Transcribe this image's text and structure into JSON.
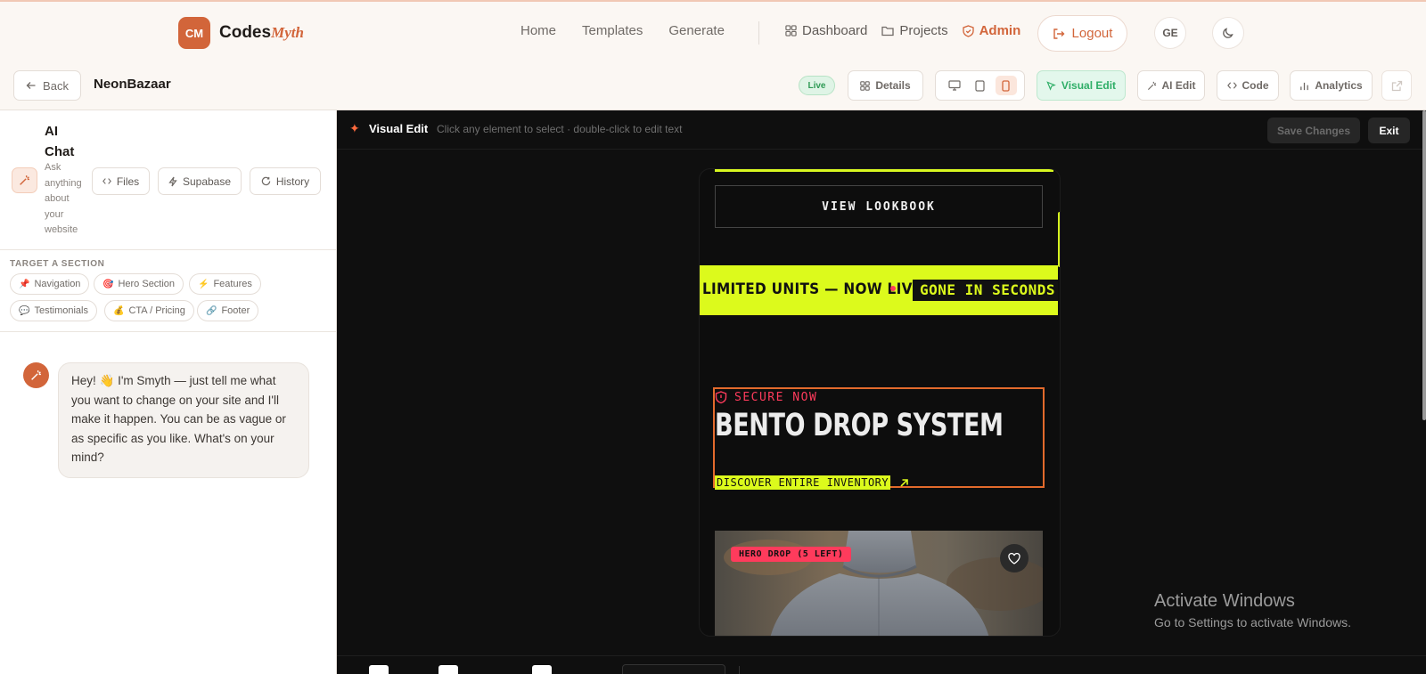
{
  "brand": {
    "mark": "CM",
    "name": "Codes",
    "accent": "Myth",
    "accent_color": "#d2653a"
  },
  "nav": {
    "links": [
      "Home",
      "Templates",
      "Generate"
    ],
    "dashboard": "Dashboard",
    "projects": "Projects",
    "admin": "Admin",
    "logout": "Logout",
    "avatar_initials": "GE"
  },
  "project": {
    "back": "Back",
    "name": "NeonBazaar",
    "status": "Live",
    "details": "Details",
    "visual_edit": "Visual Edit",
    "ai_edit": "AI Edit",
    "code": "Code",
    "analytics": "Analytics",
    "active_device": "mobile"
  },
  "chat": {
    "title": "AI Chat",
    "subtitle": "Ask anything about your website",
    "tools": [
      "Files",
      "Supabase",
      "History"
    ],
    "target_label": "TARGET A SECTION",
    "sections": [
      {
        "emoji": "📌",
        "label": "Navigation"
      },
      {
        "emoji": "🎯",
        "label": "Hero Section"
      },
      {
        "emoji": "⚡",
        "label": "Features"
      },
      {
        "emoji": "💬",
        "label": "Testimonials"
      },
      {
        "emoji": "💰",
        "label": "CTA / Pricing"
      },
      {
        "emoji": "🔗",
        "label": "Footer"
      }
    ],
    "message": "Hey! 👋 I'm Smyth — just tell me what you want to change on your site and I'll make it happen. You can be as vague or as specific as you like. What's on your mind?"
  },
  "editor": {
    "title": "Visual Edit",
    "hint": "Click any element to select · double-click to edit text",
    "save": "Save Changes",
    "exit": "Exit"
  },
  "preview": {
    "lookbook": "VIEW LOOKBOOK",
    "marquee_text": "LIMITED UNITS — NOW LIVE",
    "marquee_box": "GONE IN SECONDS",
    "secure": "SECURE NOW",
    "hero_title": "BENTO DROP SYSTEM",
    "discover": "DISCOVER ENTIRE INVENTORY",
    "badge": "HERO DROP (5 LEFT)",
    "accent_color": "#dcfa1c",
    "alert_color": "#ff3b5c"
  },
  "watermark": {
    "line1": "Activate Windows",
    "line2": "Go to Settings to activate Windows."
  }
}
